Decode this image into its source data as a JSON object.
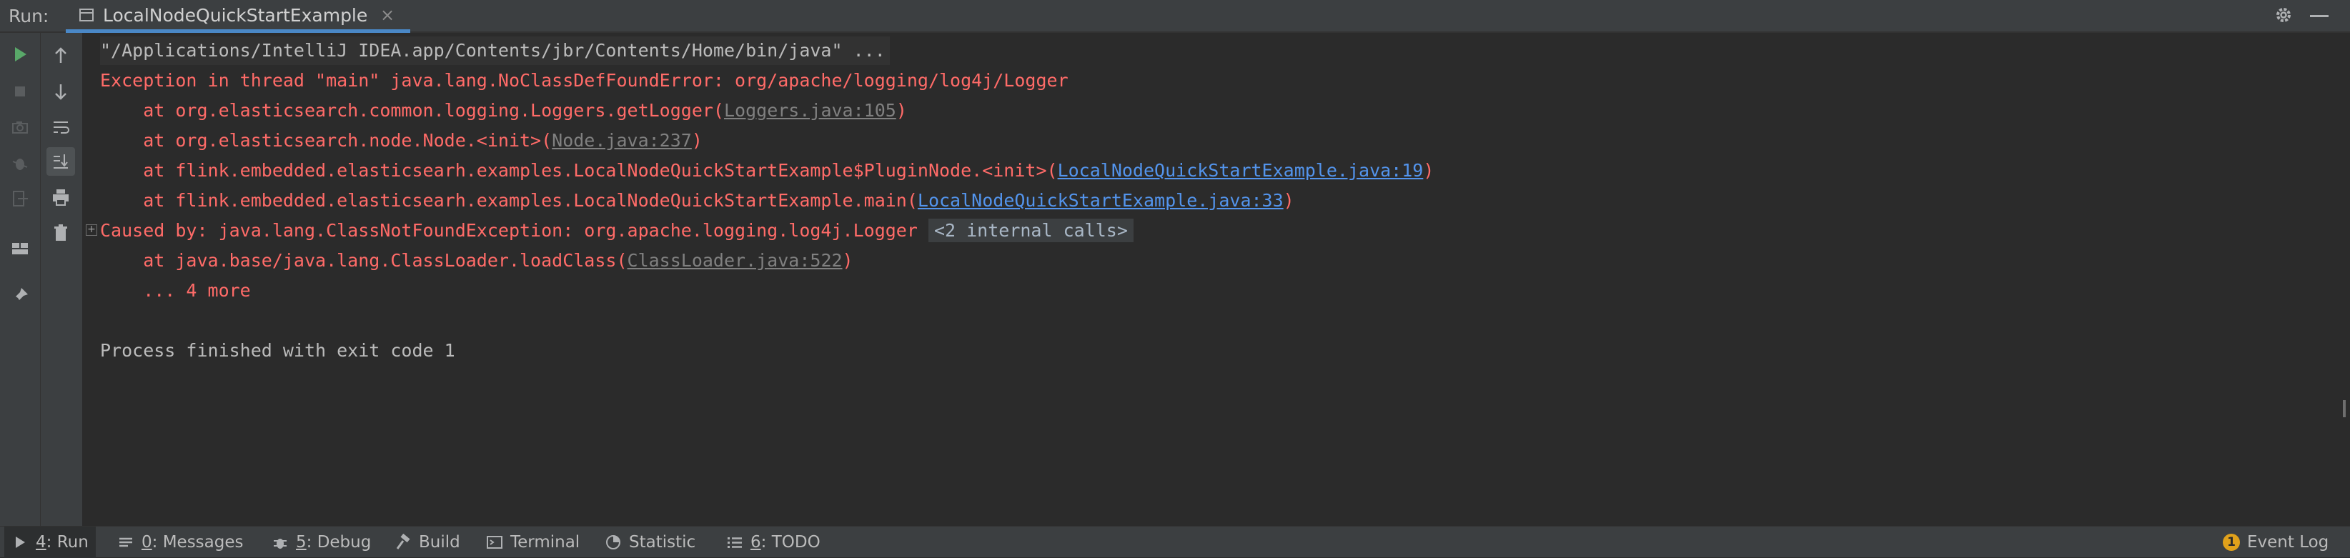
{
  "header": {
    "run_label": "Run:",
    "tab_title": "LocalNodeQuickStartExample",
    "tab_close": "×"
  },
  "console": {
    "command": "\"/Applications/IntelliJ IDEA.app/Contents/jbr/Contents/Home/bin/java\" ...",
    "exception": "Exception in thread \"main\" java.lang.NoClassDefFoundError: org/apache/logging/log4j/Logger",
    "frames": [
      {
        "prefix": "    at org.elasticsearch.common.logging.Loggers.getLogger(",
        "link": "Loggers.java:105",
        "suffix": ")",
        "link_style": "gray"
      },
      {
        "prefix": "    at org.elasticsearch.node.Node.<init>(",
        "link": "Node.java:237",
        "suffix": ")",
        "link_style": "gray"
      },
      {
        "prefix": "    at flink.embedded.elasticsearh.examples.LocalNodeQuickStartExample$PluginNode.<init>(",
        "link": "LocalNodeQuickStartExample.java:19",
        "suffix": ")",
        "link_style": "blue"
      },
      {
        "prefix": "    at flink.embedded.elasticsearh.examples.LocalNodeQuickStartExample.main(",
        "link": "LocalNodeQuickStartExample.java:33",
        "suffix": ")",
        "link_style": "blue"
      }
    ],
    "caused_by": "Caused by: java.lang.ClassNotFoundException: org.apache.logging.log4j.Logger",
    "internal_calls": "<2 internal calls>",
    "cause_frame": {
      "prefix": "    at java.base/java.lang.ClassLoader.loadClass(",
      "link": "ClassLoader.java:522",
      "suffix": ")"
    },
    "more": "    ... 4 more",
    "exit": "Process finished with exit code 1"
  },
  "bottom_tabs": [
    {
      "mnemonic": "4",
      "label": ": Run",
      "icon": "play-icon",
      "active": true
    },
    {
      "mnemonic": "0",
      "label": ": Messages",
      "icon": "messages-icon"
    },
    {
      "mnemonic": "5",
      "label": ": Debug",
      "icon": "bug-icon"
    },
    {
      "mnemonic": "",
      "label": "Build",
      "icon": "hammer-icon"
    },
    {
      "mnemonic": "",
      "label": "Terminal",
      "icon": "terminal-icon"
    },
    {
      "mnemonic": "",
      "label": "Statistic",
      "icon": "statistic-icon"
    },
    {
      "mnemonic": "6",
      "label": ": TODO",
      "icon": "todo-icon"
    }
  ],
  "event_log": {
    "count": "1",
    "label": "Event Log"
  },
  "colors": {
    "error": "#ff6b68",
    "link": "#5394ec",
    "accent": "#4a88c7",
    "run_green": "#59a869"
  }
}
